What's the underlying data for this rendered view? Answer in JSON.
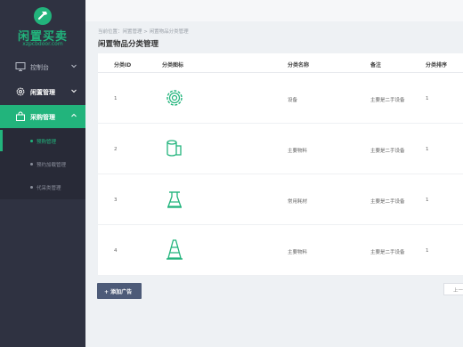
{
  "logo": {
    "title": "闲置买卖",
    "subtitle": "xzpcbdoor.com"
  },
  "nav": [
    {
      "label": "控制台",
      "icon": "monitor-icon"
    },
    {
      "label": "闲置管理",
      "icon": "gear-icon"
    },
    {
      "label": "采购管理",
      "icon": "cart-icon"
    }
  ],
  "subnav": [
    "预购管理",
    "预约加载管理",
    "代采类管理"
  ],
  "breadcrumb": "当前位置：闲置管理 > 闲置物品分类管理",
  "page_title": "闲置物品分类管理",
  "table": {
    "headers": [
      "分类ID",
      "分类图标",
      "分类名称",
      "备注",
      "分类排序"
    ],
    "rows": [
      {
        "id": "1",
        "icon": "gear-icon",
        "name": "设备",
        "note": "主要是二手设备",
        "order": "1"
      },
      {
        "id": "2",
        "icon": "cylinder-icon",
        "name": "主要物料",
        "note": "主要是二手设备",
        "order": "1"
      },
      {
        "id": "3",
        "icon": "flask-icon",
        "name": "常用耗材",
        "note": "主要是二手设备",
        "order": "1"
      },
      {
        "id": "4",
        "icon": "cone-icon",
        "name": "主要物料",
        "note": "主要是二手设备",
        "order": "1"
      }
    ]
  },
  "add_button": "+ 添加广告",
  "prev_button": "上一页",
  "colors": {
    "accent": "#22b47c",
    "sidebar": "#2f3241",
    "button": "#4d5b78"
  }
}
